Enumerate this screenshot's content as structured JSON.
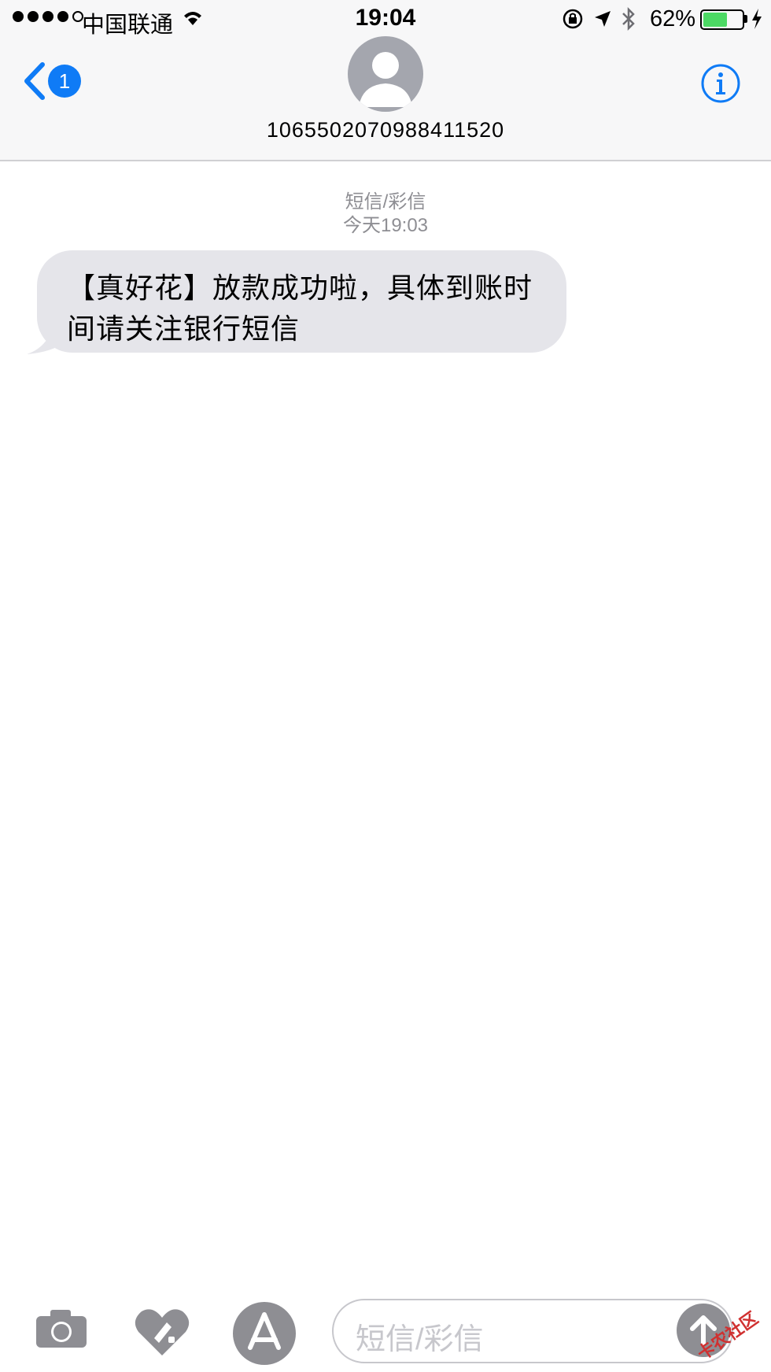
{
  "status_bar": {
    "carrier": "中国联通",
    "time": "19:04",
    "battery_percent": "62%",
    "battery_level": 0.62,
    "icons": [
      "signal-dots-icon",
      "wifi-icon",
      "rotation-lock-icon",
      "location-arrow-icon",
      "bluetooth-icon",
      "battery-icon",
      "charging-bolt-icon"
    ]
  },
  "nav": {
    "unread_count": "1",
    "contact_number": "1065502070988411520"
  },
  "conversation": {
    "service_label": "短信/彩信",
    "timestamp": "今天19:03",
    "messages": [
      {
        "text": "【真好花】放款成功啦，具体到账时间请关注银行短信",
        "direction": "incoming"
      }
    ]
  },
  "composer": {
    "placeholder": "短信/彩信",
    "icons": [
      "camera-icon",
      "digital-touch-icon",
      "app-store-icon",
      "send-arrow-icon"
    ]
  },
  "watermark": "卡农社区",
  "colors": {
    "accent": "#0f7bf6",
    "bubble_bg": "#e5e5ea",
    "battery": "#4cd964",
    "header_bg": "#f7f7f8",
    "gray_text": "#8e8e93"
  }
}
